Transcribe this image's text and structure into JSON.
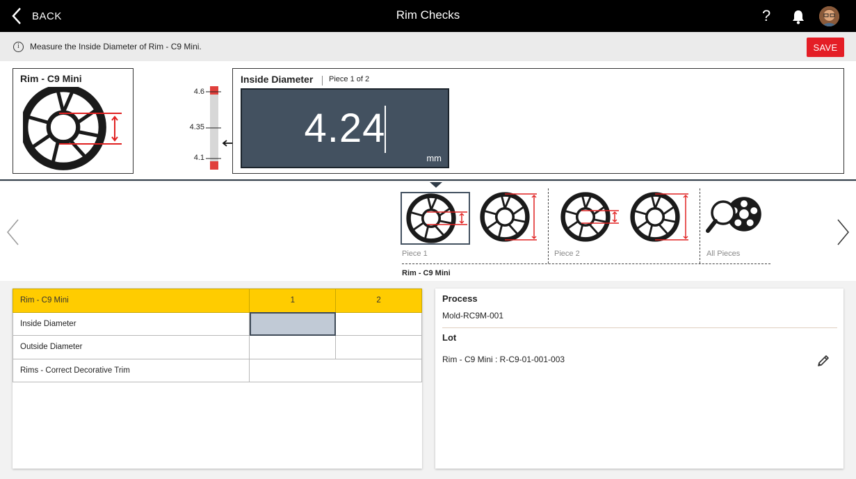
{
  "header": {
    "back_label": "BACK",
    "title": "Rim Checks",
    "help_label": "?",
    "icons": [
      "chevron-left-icon",
      "help-icon",
      "bell-icon",
      "avatar"
    ]
  },
  "info": {
    "icon": "info-icon",
    "message": "Measure the Inside Diameter of Rim - C9 Mini.",
    "save_label": "SAVE"
  },
  "part": {
    "name": "Rim - C9 Mini"
  },
  "gauge": {
    "upper": "4.6",
    "nominal": "4.35",
    "lower": "4.1"
  },
  "reading": {
    "title": "Inside Diameter",
    "piece_label": "Piece 1 of 2",
    "value": "4.24",
    "unit": "mm"
  },
  "carousel": {
    "groups": [
      {
        "label": "Piece 1"
      },
      {
        "label": "Piece 2"
      },
      {
        "label": "All Pieces"
      }
    ],
    "caption": "Rim - C9 Mini"
  },
  "table": {
    "header": [
      "Rim - C9 Mini",
      "1",
      "2"
    ],
    "rows": [
      {
        "label": "Inside Diameter"
      },
      {
        "label": "Outside Diameter"
      },
      {
        "label": "Rims - Correct Decorative Trim"
      }
    ]
  },
  "details": {
    "process_label": "Process",
    "process_value": "Mold-RC9M-001",
    "lot_label": "Lot",
    "lot_value": "Rim - C9 Mini : R-C9-01-001-003"
  },
  "colors": {
    "accent_red": "#e41e26",
    "header_yellow": "#ffcc00",
    "display_bg": "#435160"
  }
}
